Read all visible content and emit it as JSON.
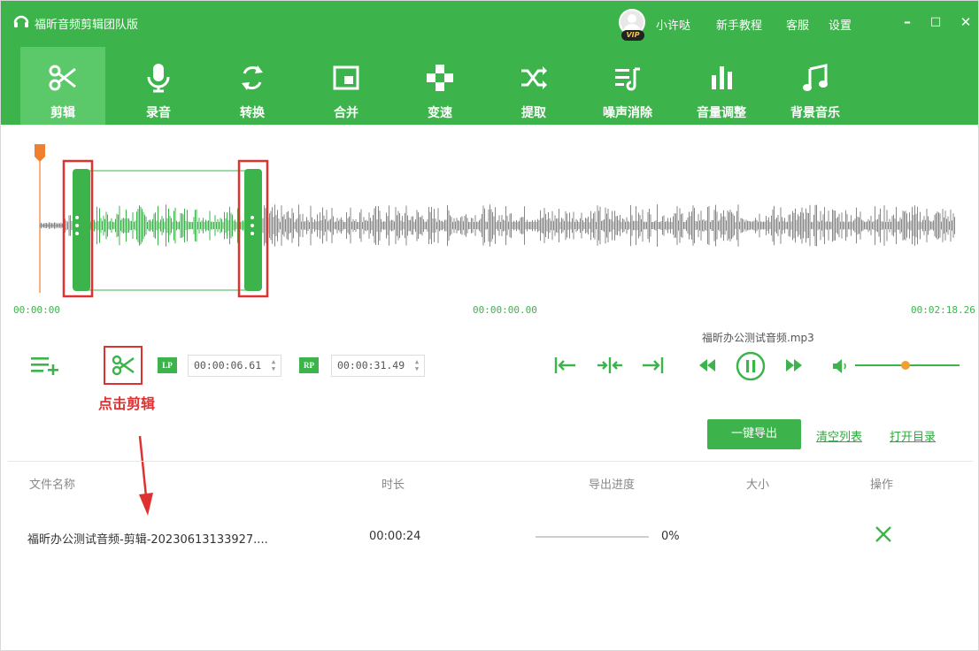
{
  "app": {
    "title": "福昕音频剪辑团队版",
    "vip_label": "VIP",
    "user_name": "小许哒",
    "links": [
      "新手教程",
      "客服",
      "设置"
    ]
  },
  "window_controls": {
    "minimize": "–",
    "maximize": "□",
    "close": "✕"
  },
  "toolbar": {
    "items": [
      {
        "label": "剪辑",
        "icon": "scissors-icon",
        "active": true
      },
      {
        "label": "录音",
        "icon": "microphone-icon"
      },
      {
        "label": "转换",
        "icon": "convert-icon"
      },
      {
        "label": "合并",
        "icon": "merge-icon"
      },
      {
        "label": "变速",
        "icon": "speed-icon"
      },
      {
        "label": "提取",
        "icon": "extract-icon"
      },
      {
        "label": "噪声消除",
        "icon": "noise-removal-icon"
      },
      {
        "label": "音量调整",
        "icon": "volume-adjust-icon"
      },
      {
        "label": "背景音乐",
        "icon": "music-note-icon"
      }
    ]
  },
  "waveform": {
    "start_time": "00:00:00",
    "mid_time": "00:00:00.00",
    "end_time": "00:02:18.26",
    "selection_start_fraction": 0.045,
    "selection_end_fraction": 0.245
  },
  "editor": {
    "file_name": "福昕办公测试音频.mp3",
    "lp_label": "LP",
    "rp_label": "RP",
    "start_value": "00:00:06.61",
    "end_value": "00:00:31.49",
    "annotation": "点击剪辑",
    "volume_level": 0.48
  },
  "actions": {
    "export_label": "一键导出",
    "clear_label": "清空列表",
    "open_label": "打开目录"
  },
  "table": {
    "headers": [
      "文件名称",
      "时长",
      "导出进度",
      "大小",
      "操作"
    ],
    "rows": [
      {
        "name": "福昕办公测试音频-剪辑-20230613133927....",
        "duration": "00:00:24",
        "progress_text": "0%",
        "progress": 0,
        "size": ""
      }
    ]
  },
  "colors": {
    "brand_green": "#3cb44b",
    "annotation_red": "#e03131",
    "playhead_orange": "#f08030"
  }
}
